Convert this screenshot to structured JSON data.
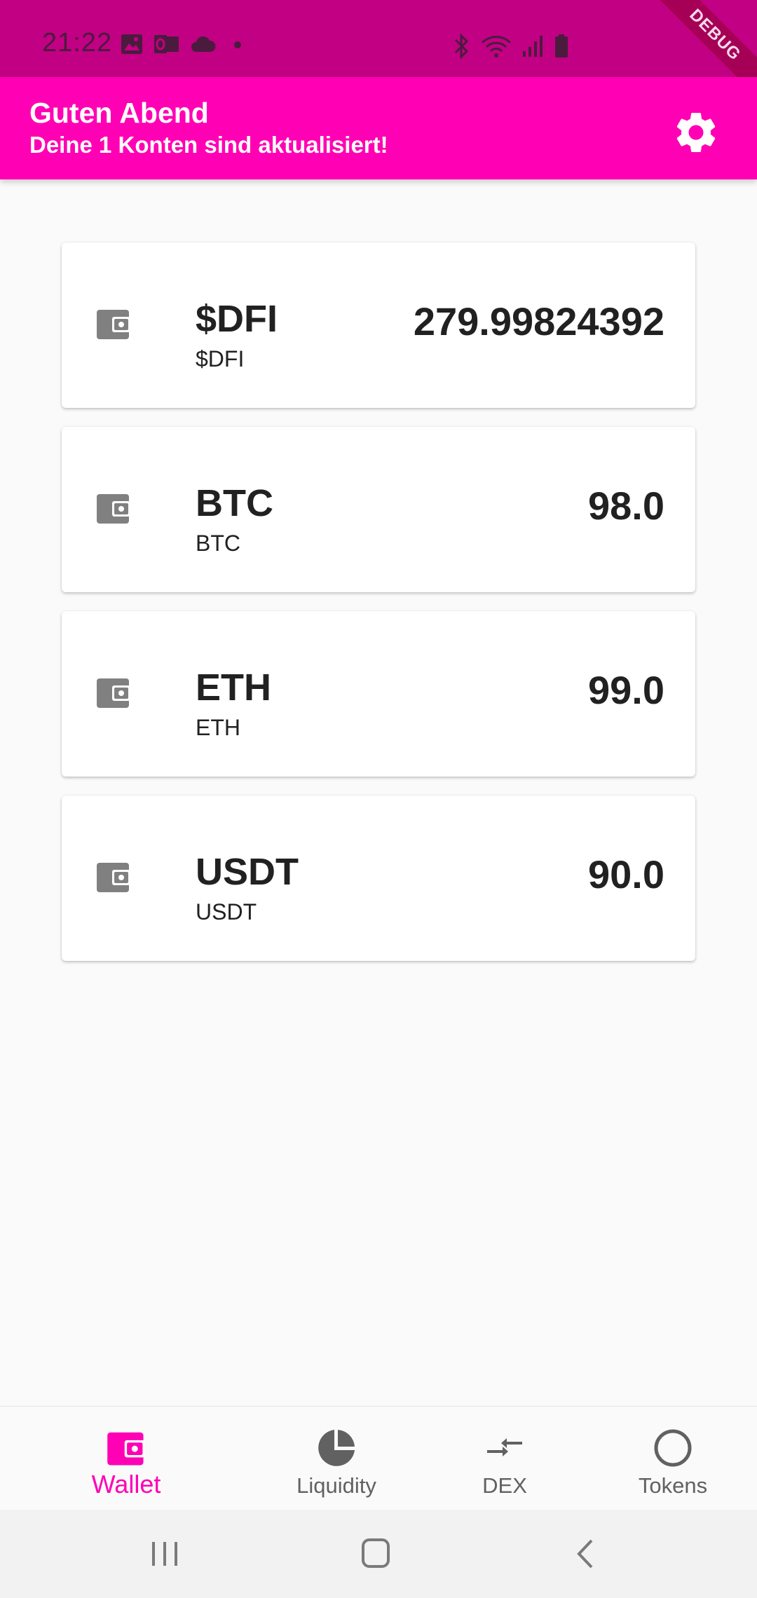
{
  "status_bar": {
    "time": "21:22",
    "left_icons": [
      "image-icon",
      "outlook-icon",
      "cloud-icon",
      "dot-icon"
    ],
    "right_icons": [
      "bluetooth-icon",
      "wifi-icon",
      "signal-icon",
      "battery-icon"
    ],
    "debug_label": "DEBUG"
  },
  "app_bar": {
    "greeting": "Guten Abend",
    "subtitle": "Deine 1 Konten sind aktualisiert!",
    "settings_icon": "gear-icon"
  },
  "accounts": [
    {
      "title": "$DFI",
      "subtitle": "$DFI",
      "value": "279.99824392",
      "icon": "wallet-icon"
    },
    {
      "title": "BTC",
      "subtitle": "BTC",
      "value": "98.0",
      "icon": "wallet-icon"
    },
    {
      "title": "ETH",
      "subtitle": "ETH",
      "value": "99.0",
      "icon": "wallet-icon"
    },
    {
      "title": "USDT",
      "subtitle": "USDT",
      "value": "90.0",
      "icon": "wallet-icon"
    }
  ],
  "bottom_nav": {
    "items": [
      {
        "label": "Wallet",
        "icon": "wallet-icon",
        "active": true
      },
      {
        "label": "Liquidity",
        "icon": "pie-chart-icon",
        "active": false
      },
      {
        "label": "DEX",
        "icon": "swap-arrows-icon",
        "active": false
      },
      {
        "label": "Tokens",
        "icon": "circle-icon",
        "active": false
      }
    ]
  },
  "colors": {
    "primary": "#ff00b4",
    "status_bar": "#c20083",
    "card_icon": "#808080",
    "text": "#212121"
  }
}
